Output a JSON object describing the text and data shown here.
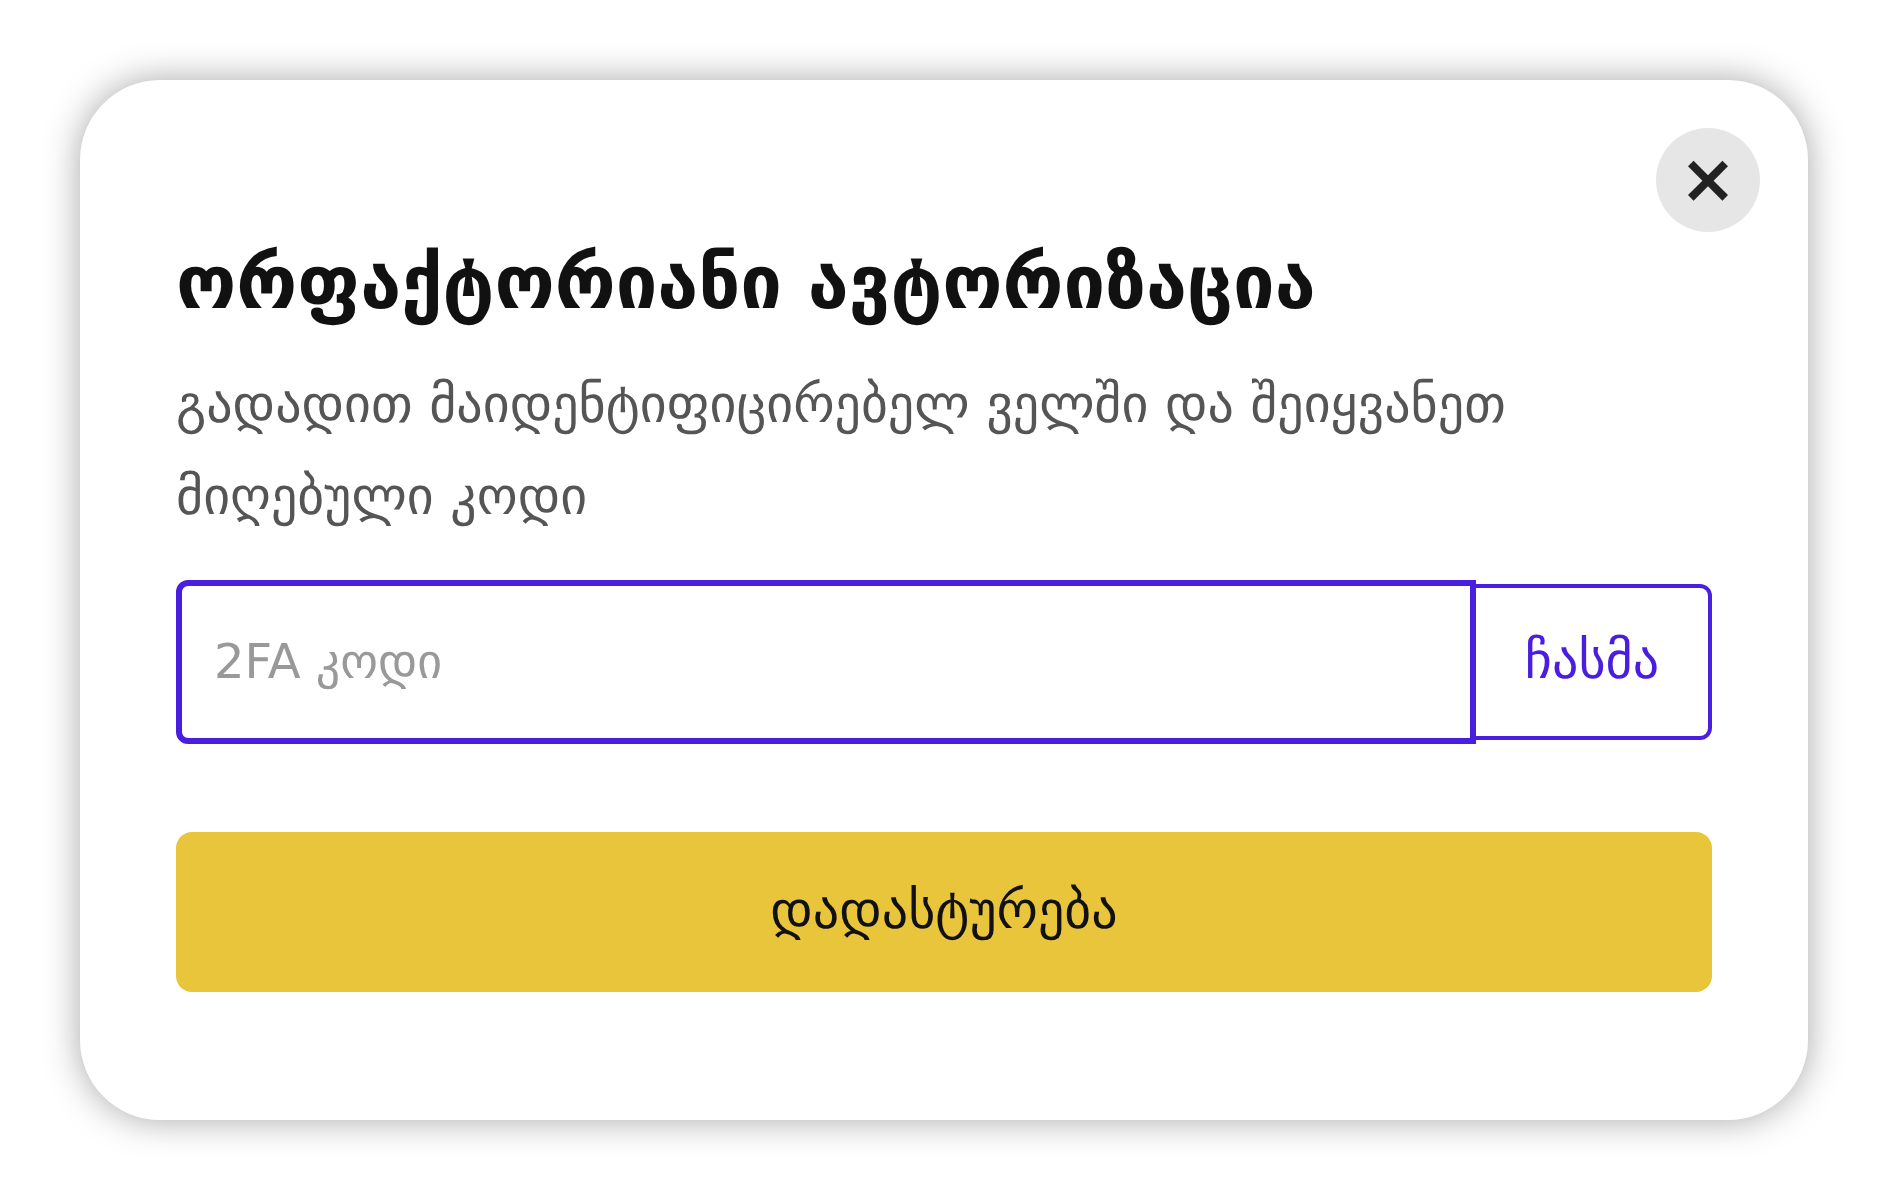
{
  "dialog": {
    "close": "×",
    "title": "ორფაქტორიანი ავტორიზაცია",
    "description": "გადადით მაიდენტიფიცირებელ ველში და შეიყვანეთ მიღებული კოდი",
    "code_field": {
      "placeholder": "2FA კოდი",
      "focused": true
    },
    "paste_button": "ჩასმა",
    "confirm_button": "დადასტურება"
  }
}
